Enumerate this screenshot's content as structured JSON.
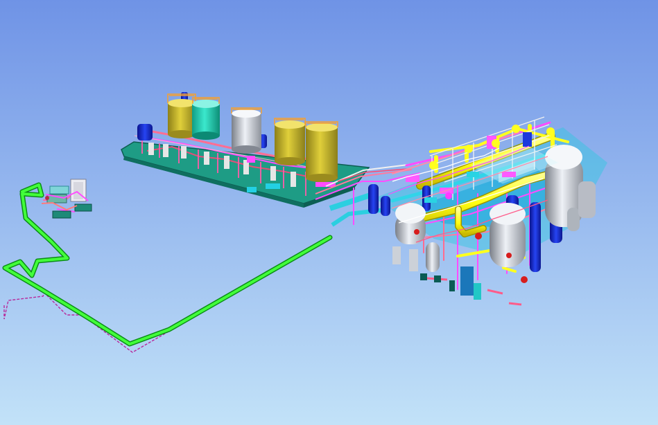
{
  "scene": {
    "background_top": "#6f93e6",
    "background_bottom": "#bfe0f8",
    "colors": {
      "deck": "#1f9d83",
      "deck_dark": "#12705e",
      "pipe_yellow": "#ffff24",
      "pipe_green": "#19e619",
      "pipe_magenta": "#ff4cff",
      "pipe_pink": "#ff80a0",
      "tank_gold": "#d5c52a",
      "tank_cyan": "#2ee5c6",
      "vessel_gray": "#c8ccd4",
      "equipment_blue": "#1326d6",
      "equipment_cyan": "#22e0ee",
      "skid_teal": "#15a08a"
    },
    "objects": [
      "tank-farm-skid",
      "process-plant-module",
      "pump-station",
      "pipeline-route",
      "cable-route"
    ]
  }
}
